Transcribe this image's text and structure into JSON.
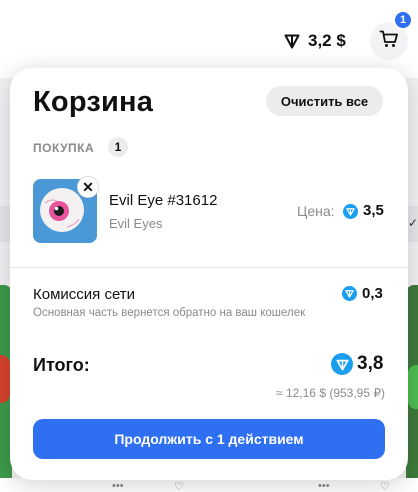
{
  "header": {
    "balance": "3,2 $",
    "cart_count": "1"
  },
  "cart": {
    "title": "Корзина",
    "clear_label": "Очистить все",
    "section_label": "ПОКУПКА",
    "section_count": "1",
    "items": [
      {
        "name": "Evil Eye #31612",
        "collection": "Evil Eyes",
        "price_label": "Цена:",
        "price": "3,5"
      }
    ],
    "fee": {
      "label": "Комиссия сети",
      "value": "0,3",
      "note": "Основная часть вернется обратно на ваш кошелек"
    },
    "total": {
      "label": "Итого:",
      "value": "3,8",
      "fiat": "≈ 12,16 $ (953,95 ₽)"
    },
    "continue_label": "Продолжить с 1 действием"
  },
  "colors": {
    "accent": "#2f6ff2",
    "ton": "#1a9ff0",
    "muted_text": "#8a8a8f"
  },
  "icons": {
    "currency": "ton-diamond-icon",
    "cart": "shopping-cart-icon",
    "remove": "close-icon"
  }
}
